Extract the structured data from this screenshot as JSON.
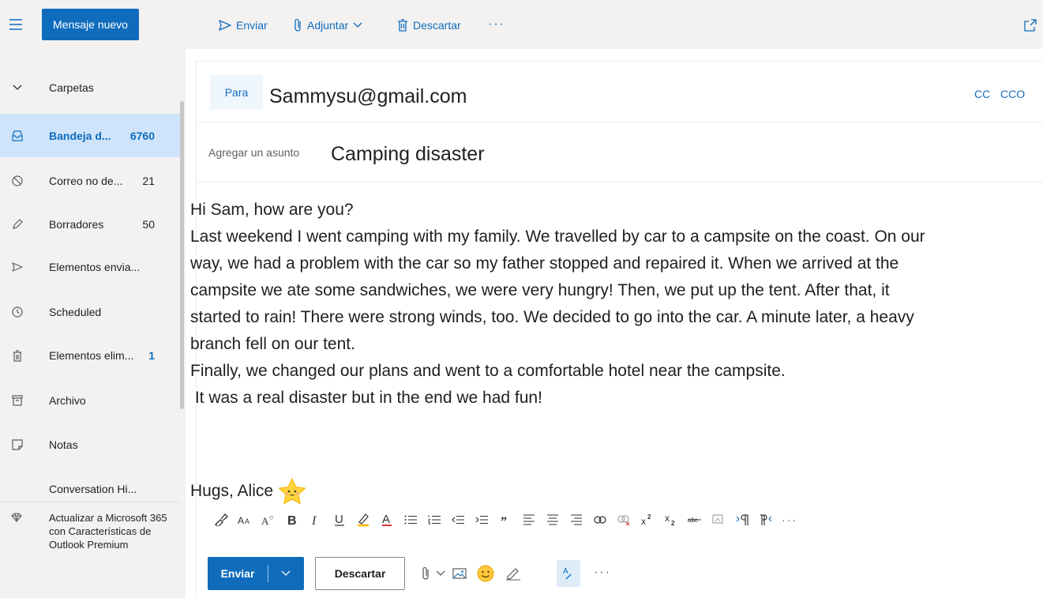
{
  "topbar": {
    "new_message": "Mensaje nuevo",
    "send": "Enviar",
    "attach": "Adjuntar",
    "discard": "Descartar",
    "more": "···"
  },
  "sidebar": {
    "folders_label": "Carpetas",
    "items": [
      {
        "label": "Bandeja d...",
        "count": "6760"
      },
      {
        "label": "Correo no de...",
        "count": "21"
      },
      {
        "label": "Borradores",
        "count": "50"
      },
      {
        "label": "Elementos envia...",
        "count": ""
      },
      {
        "label": "Scheduled",
        "count": ""
      },
      {
        "label": "Elementos elim...",
        "count": "1"
      },
      {
        "label": "Archivo",
        "count": ""
      },
      {
        "label": "Notas",
        "count": ""
      },
      {
        "label": "Conversation Hi...",
        "count": ""
      }
    ],
    "upgrade": "Actualizar a Microsoft 365 con Características de Outlook Premium"
  },
  "compose": {
    "to_label": "Para",
    "to_value": "Sammysu@gmail.com",
    "cc": "CC",
    "cco": "CCO",
    "subject_placeholder": "Agregar un asunto",
    "subject_value": "Camping disaster",
    "body_lines": [
      "Hi Sam, how are you?",
      "Last weekend I went camping with my family. We travelled by car to a campsite on the coast. On our",
      "way, we had a problem with the car so my father stopped and repaired it. When we arrived at the",
      "campsite we ate some sandwiches, we were very hungry! Then, we put up the tent. After that, it",
      "started to rain! There were strong winds, too. We decided to go into the car. A minute later, a heavy",
      "branch fell on our tent.",
      "Finally, we changed our plans and went to a comfortable hotel near the campsite.",
      " It was a real disaster but in the end we had fun!"
    ],
    "signature": "Hugs, Alice"
  },
  "actions": {
    "send": "Enviar",
    "discard": "Descartar",
    "more": "···"
  },
  "colors": {
    "accent": "#0f6cbd",
    "sidebar_bg": "#f3f2f1",
    "active_bg": "#cfe4fa"
  }
}
